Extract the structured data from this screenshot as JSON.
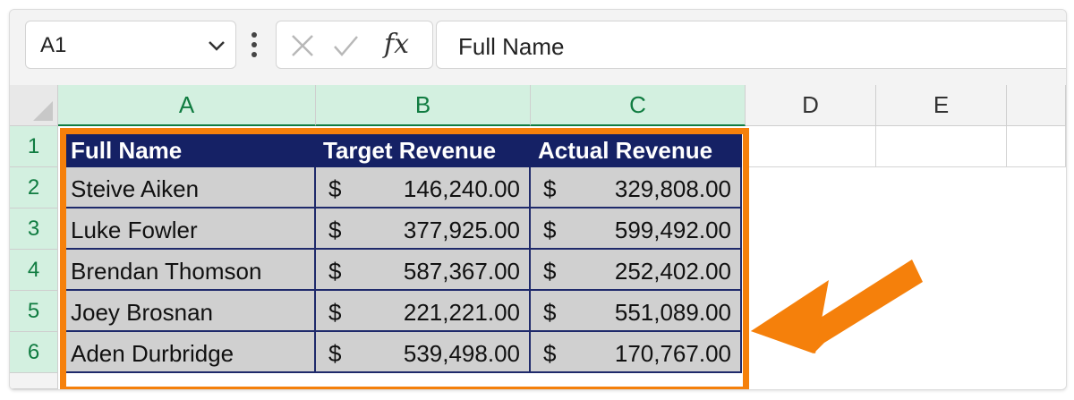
{
  "name_box": {
    "value": "A1"
  },
  "formula_bar": {
    "fx_label": "fx",
    "value": "Full Name"
  },
  "columns": [
    "A",
    "B",
    "C",
    "D",
    "E"
  ],
  "rows": [
    "1",
    "2",
    "3",
    "4",
    "5",
    "6"
  ],
  "table": {
    "headers": [
      "Full Name",
      "Target Revenue",
      "Actual Revenue"
    ],
    "currency_symbol": "$",
    "records": [
      {
        "name": "Steive Aiken",
        "target": "146,240.00",
        "actual": "329,808.00"
      },
      {
        "name": "Luke Fowler",
        "target": "377,925.00",
        "actual": "599,492.00"
      },
      {
        "name": "Brendan Thomson",
        "target": "587,367.00",
        "actual": "252,402.00"
      },
      {
        "name": "Joey Brosnan",
        "target": "221,221.00",
        "actual": "551,089.00"
      },
      {
        "name": "Aden Durbridge",
        "target": "539,498.00",
        "actual": "170,767.00"
      }
    ]
  },
  "colors": {
    "header_fill": "#152165",
    "data_fill": "#d0d0d0",
    "selection_green": "#107c41",
    "highlight_orange": "#f5800b"
  }
}
